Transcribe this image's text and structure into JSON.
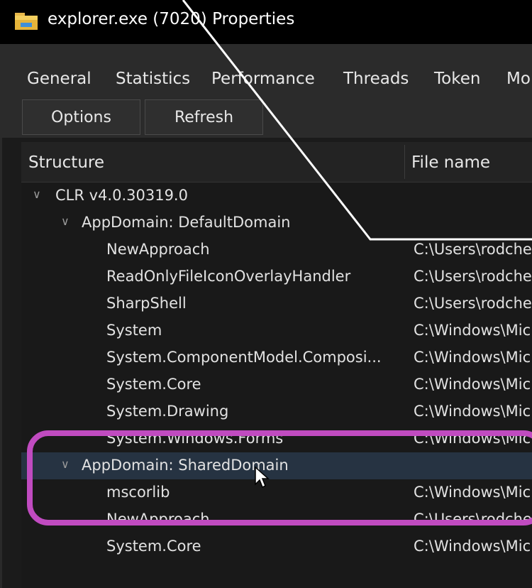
{
  "window": {
    "title": "explorer.exe (7020) Properties",
    "icon": "folder-icon"
  },
  "tabs": [
    "General",
    "Statistics",
    "Performance",
    "Threads",
    "Token",
    "Mo"
  ],
  "toolbar": {
    "options_label": "Options",
    "refresh_label": "Refresh"
  },
  "columns": {
    "structure": "Structure",
    "file_name": "File name"
  },
  "tree": {
    "clr": "CLR v4.0.30319.0",
    "default_domain": "AppDomain: DefaultDomain",
    "default_items": [
      {
        "name": "NewApproach",
        "file": "C:\\Users\\rodche"
      },
      {
        "name": "ReadOnlyFileIconOverlayHandler",
        "file": "C:\\Users\\rodche"
      },
      {
        "name": "SharpShell",
        "file": "C:\\Users\\rodche"
      },
      {
        "name": "System",
        "file": "C:\\Windows\\Mic"
      },
      {
        "name": "System.ComponentModel.Composi...",
        "file": "C:\\Windows\\Mic"
      },
      {
        "name": "System.Core",
        "file": "C:\\Windows\\Mic"
      },
      {
        "name": "System.Drawing",
        "file": "C:\\Windows\\Mic"
      },
      {
        "name": "System.Windows.Forms",
        "file": "C:\\Windows\\Mic"
      }
    ],
    "shared_domain": "AppDomain: SharedDomain",
    "shared_items": [
      {
        "name": "mscorlib",
        "file": "C:\\Windows\\Mic"
      },
      {
        "name": "NewApproach",
        "file": "C:\\Users\\rodche"
      },
      {
        "name": "System.Core",
        "file": "C:\\Windows\\Mic"
      }
    ]
  },
  "colors": {
    "highlight": "#c04bc0",
    "selected_row": "#263342"
  }
}
